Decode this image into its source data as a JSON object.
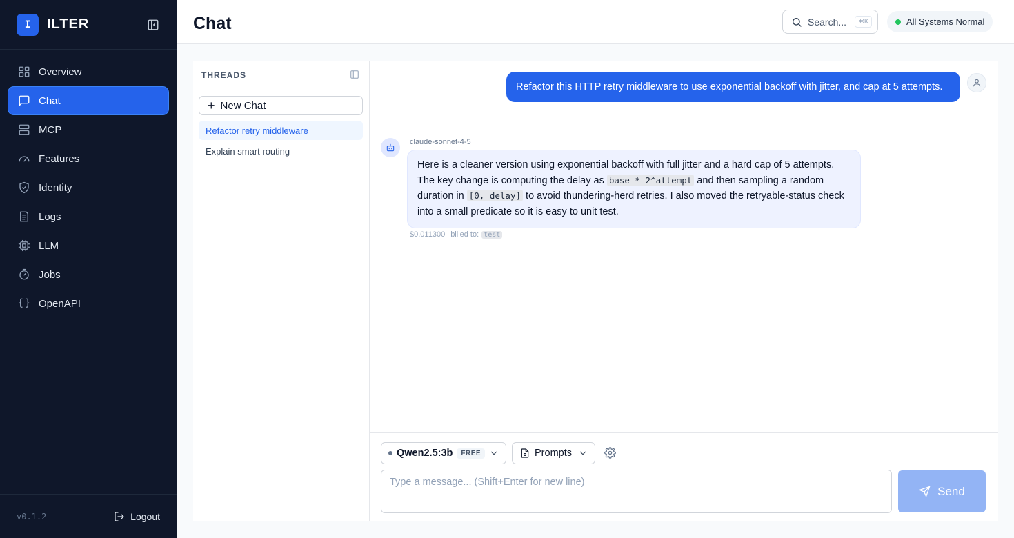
{
  "brand": {
    "logo_letter": "I",
    "name": "ILTER"
  },
  "sidebar": {
    "items": [
      {
        "label": "Overview",
        "icon": "grid-icon"
      },
      {
        "label": "Chat",
        "icon": "chat-icon"
      },
      {
        "label": "MCP",
        "icon": "server-icon"
      },
      {
        "label": "Features",
        "icon": "gauge-icon"
      },
      {
        "label": "Identity",
        "icon": "shield-icon"
      },
      {
        "label": "Logs",
        "icon": "logs-icon"
      },
      {
        "label": "LLM",
        "icon": "cpu-icon"
      },
      {
        "label": "Jobs",
        "icon": "timer-icon"
      },
      {
        "label": "OpenAPI",
        "icon": "braces-icon"
      }
    ],
    "active": "Chat",
    "version": "v0.1.2",
    "logout_label": "Logout"
  },
  "header": {
    "title": "Chat",
    "search_placeholder": "Search...",
    "search_shortcut": "⌘K",
    "status_text": "All Systems Normal",
    "status_color": "#22c55e"
  },
  "threads": {
    "title": "THREADS",
    "new_chat_label": "New Chat",
    "items": [
      {
        "label": "Refactor retry middleware",
        "active": true
      },
      {
        "label": "Explain smart routing",
        "active": false
      }
    ]
  },
  "messages": {
    "user": "Refactor this HTTP retry middleware to use exponential backoff with jitter, and cap at 5 attempts.",
    "bot": {
      "model": "claude-sonnet-4-5",
      "text_1": "Here is a cleaner version using exponential backoff with full jitter and a hard cap of 5 attempts. The key change is computing the delay as ",
      "code_1": "base * 2^attempt",
      "text_2": " and then sampling a random duration in ",
      "code_2": "[0, delay]",
      "text_3": " to avoid thundering-herd retries. I also moved the retryable-status check into a small predicate so it is easy to unit test.",
      "cost": "$0.011300",
      "billed_label": "billed to:",
      "billed_to": "test"
    }
  },
  "composer": {
    "model_name": "Qwen2.5:3b",
    "model_badge": "FREE",
    "prompts_label": "Prompts",
    "input_placeholder": "Type a message... (Shift+Enter for new line)",
    "send_label": "Send"
  },
  "colors": {
    "accent": "#2563eb",
    "sidebar_bg": "#0f172a",
    "send_disabled": "#93b4f5"
  }
}
